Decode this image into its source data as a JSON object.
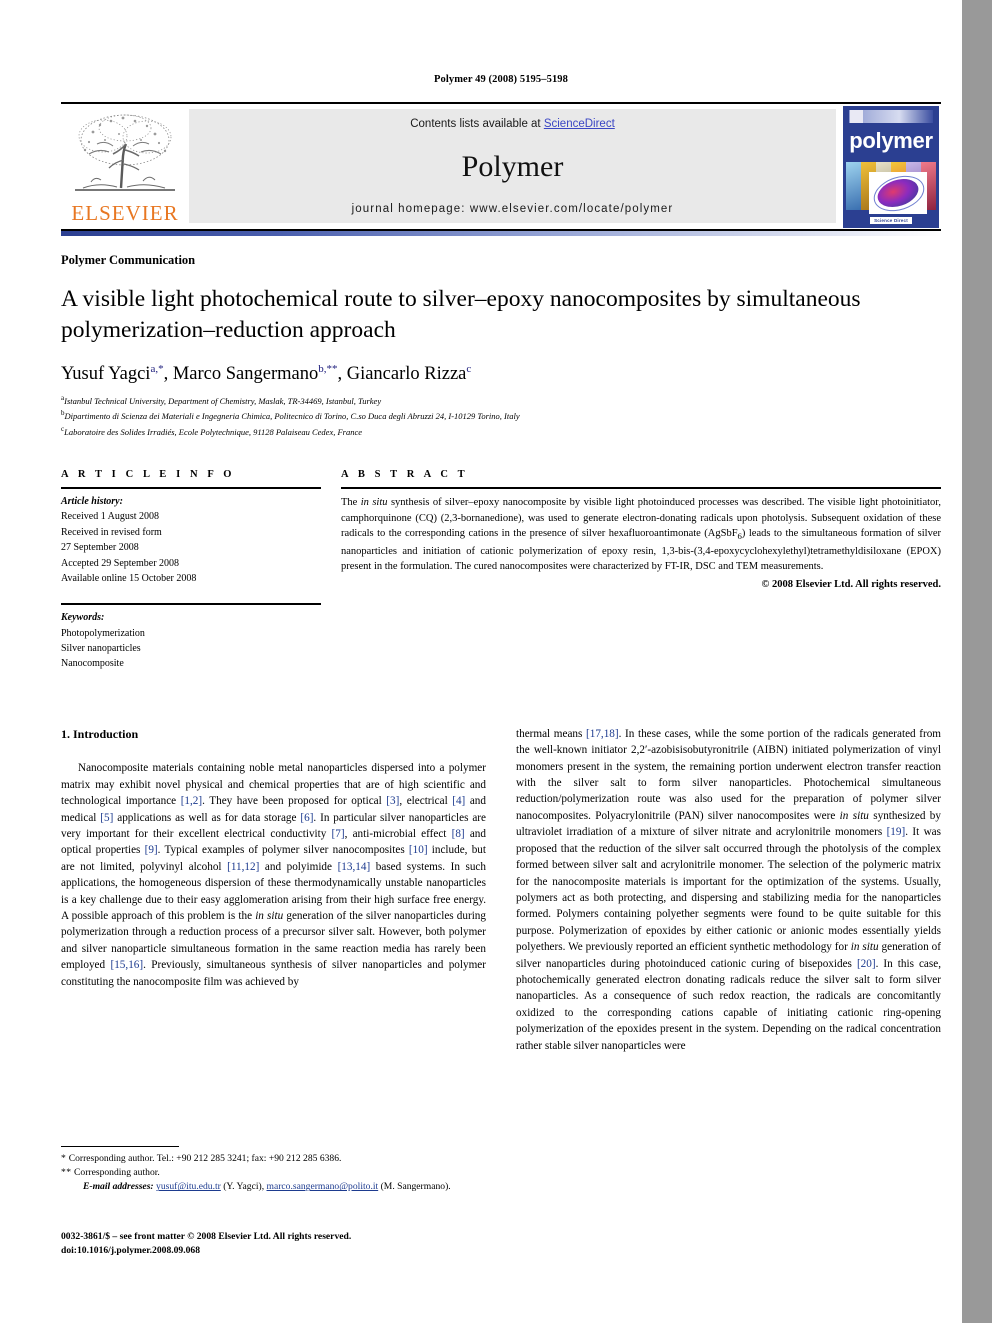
{
  "running_head": "Polymer 49 (2008) 5195–5198",
  "masthead": {
    "contents_prefix": "Contents lists available at ",
    "sciencedirect": "ScienceDirect",
    "journal_title": "Polymer",
    "homepage": "journal homepage: www.elsevier.com/locate/polymer",
    "publisher_wordmark": "ELSEVIER",
    "cover_word": "polymer",
    "cover_footer": "Science Direct",
    "accent_blue": "#2b3f91",
    "link_blue": "#3b46c4",
    "elsevier_orange": "#e87722",
    "panel_gray": "#e9e9e9"
  },
  "article": {
    "kicker": "Polymer Communication",
    "title": "A visible light photochemical route to silver–epoxy nanocomposites by simultaneous polymerization–reduction approach",
    "authors": [
      {
        "name": "Yusuf Yagci",
        "sup": "a",
        "mark": ",*"
      },
      {
        "name": "Marco Sangermano",
        "sup": "b",
        "mark": ",**"
      },
      {
        "name": "Giancarlo Rizza",
        "sup": "c",
        "mark": ""
      }
    ],
    "affiliations": [
      {
        "mark": "a",
        "text": "Istanbul Technical University, Department of Chemistry, Maslak, TR-34469, Istanbul, Turkey"
      },
      {
        "mark": "b",
        "text": "Dipartimento di Scienza dei Materiali e Ingegneria Chimica, Politecnico di Torino, C.so Duca degli Abruzzi 24, I-10129 Torino, Italy"
      },
      {
        "mark": "c",
        "text": "Laboratoire des Solides Irradiés, Ecole Polytechnique, 91128 Palaiseau Cedex, France"
      }
    ]
  },
  "article_info": {
    "heading": "A R T I C L E   I N F O",
    "history_label": "Article history:",
    "history": [
      "Received 1 August 2008",
      "Received in revised form",
      "27 September 2008",
      "Accepted 29 September 2008",
      "Available online 15 October 2008"
    ],
    "keywords_label": "Keywords:",
    "keywords": [
      "Photopolymerization",
      "Silver nanoparticles",
      "Nanocomposite"
    ]
  },
  "abstract": {
    "heading": "A B S T R A C T",
    "paragraph_html": "The <i>in situ</i> synthesis of silver–epoxy nanocomposite by visible light photoinduced processes was described. The visible light photoinitiator, camphorquinone (CQ) (2,3-bornanedione), was used to generate electron-donating radicals upon photolysis. Subsequent oxidation of these radicals to the corresponding cations in the presence of silver hexafluoroantimonate (AgSbF<sub>6</sub>) leads to the simultaneous formation of silver nanoparticles and initiation of cationic polymerization of epoxy resin, 1,3-bis-(3,4-epoxycyclohexylethyl)tetramethyldisiloxane (EPOX) present in the formulation. The cured nanocomposites were characterized by FT-IR, DSC and TEM measurements.",
    "copyright": "© 2008 Elsevier Ltd. All rights reserved."
  },
  "body": {
    "section_number_title": "1. Introduction",
    "left_column_html": "Nanocomposite materials containing noble metal nanoparticles dispersed into a polymer matrix may exhibit novel physical and chemical properties that are of high scientific and technological importance <span class=\"ref\">[1,2]</span>. They have been proposed for optical <span class=\"ref\">[3]</span>, electrical <span class=\"ref\">[4]</span> and medical <span class=\"ref\">[5]</span> applications as well as for data storage <span class=\"ref\">[6]</span>. In particular silver nanoparticles are very important for their excellent electrical conductivity <span class=\"ref\">[7]</span>, anti-microbial effect <span class=\"ref\">[8]</span> and optical properties <span class=\"ref\">[9]</span>. Typical examples of polymer silver nanocomposites <span class=\"ref\">[10]</span> include, but are not limited, polyvinyl alcohol <span class=\"ref\">[11,12]</span> and polyimide <span class=\"ref\">[13,14]</span> based systems. In such applications, the homogeneous dispersion of these thermodynamically unstable nanoparticles is a key challenge due to their easy agglomeration arising from their high surface free energy. A possible approach of this problem is the <span class=\"it\">in situ</span> generation of the silver nanoparticles during polymerization through a reduction process of a precursor silver salt. However, both polymer and silver nanoparticle simultaneous formation in the same reaction media has rarely been employed <span class=\"ref\">[15,16]</span>. Previously, simultaneous synthesis of silver nanoparticles and polymer constituting the nanocomposite film was achieved by",
    "right_column_html": "thermal means <span class=\"ref\">[17,18]</span>. In these cases, while the some portion of the radicals generated from the well-known initiator 2,2′-azobisisobutyronitrile (AIBN) initiated polymerization of vinyl monomers present in the system, the remaining portion underwent electron transfer reaction with the silver salt to form silver nanoparticles. Photochemical simultaneous reduction/polymerization route was also used for the preparation of polymer silver nanocomposites. Polyacrylonitrile (PAN) silver nanocomposites were <span class=\"it\">in situ</span> synthesized by ultraviolet irradiation of a mixture of silver nitrate and acrylonitrile monomers <span class=\"ref\">[19]</span>. It was proposed that the reduction of the silver salt occurred through the photolysis of the complex formed between silver salt and acrylonitrile monomer. The selection of the polymeric matrix for the nanocomposite materials is important for the optimization of the systems. Usually, polymers act as both protecting, and dispersing and stabilizing media for the nanoparticles formed. Polymers containing polyether segments were found to be quite suitable for this purpose. Polymerization of epoxides by either cationic or anionic modes essentially yields polyethers. We previously reported an efficient synthetic methodology for <span class=\"it\">in situ</span> generation of silver nanoparticles during photoinduced cationic curing of bisepoxides <span class=\"ref\">[20]</span>. In this case, photochemically generated electron donating radicals reduce the silver salt to form silver nanoparticles. As a consequence of such redox reaction, the radicals are concomitantly oxidized to the corresponding cations capable of initiating cationic ring-opening polymerization of the epoxides present in the system. Depending on the radical concentration rather stable silver nanoparticles were"
  },
  "footnotes": {
    "line1_mark": "*",
    "line1": "Corresponding author. Tel.: +90 212 285 3241; fax: +90 212 285 6386.",
    "line2_mark": "**",
    "line2": "Corresponding author.",
    "email_label": "E-mail addresses:",
    "email1": "yusuf@itu.edu.tr",
    "email1_owner": "(Y. Yagci)",
    "email2": "marco.sangermano@polito.it",
    "email2_owner": "(M. Sangermano)."
  },
  "colophon": {
    "line1": "0032-3861/$ – see front matter © 2008 Elsevier Ltd. All rights reserved.",
    "line2": "doi:10.1016/j.polymer.2008.09.068"
  }
}
